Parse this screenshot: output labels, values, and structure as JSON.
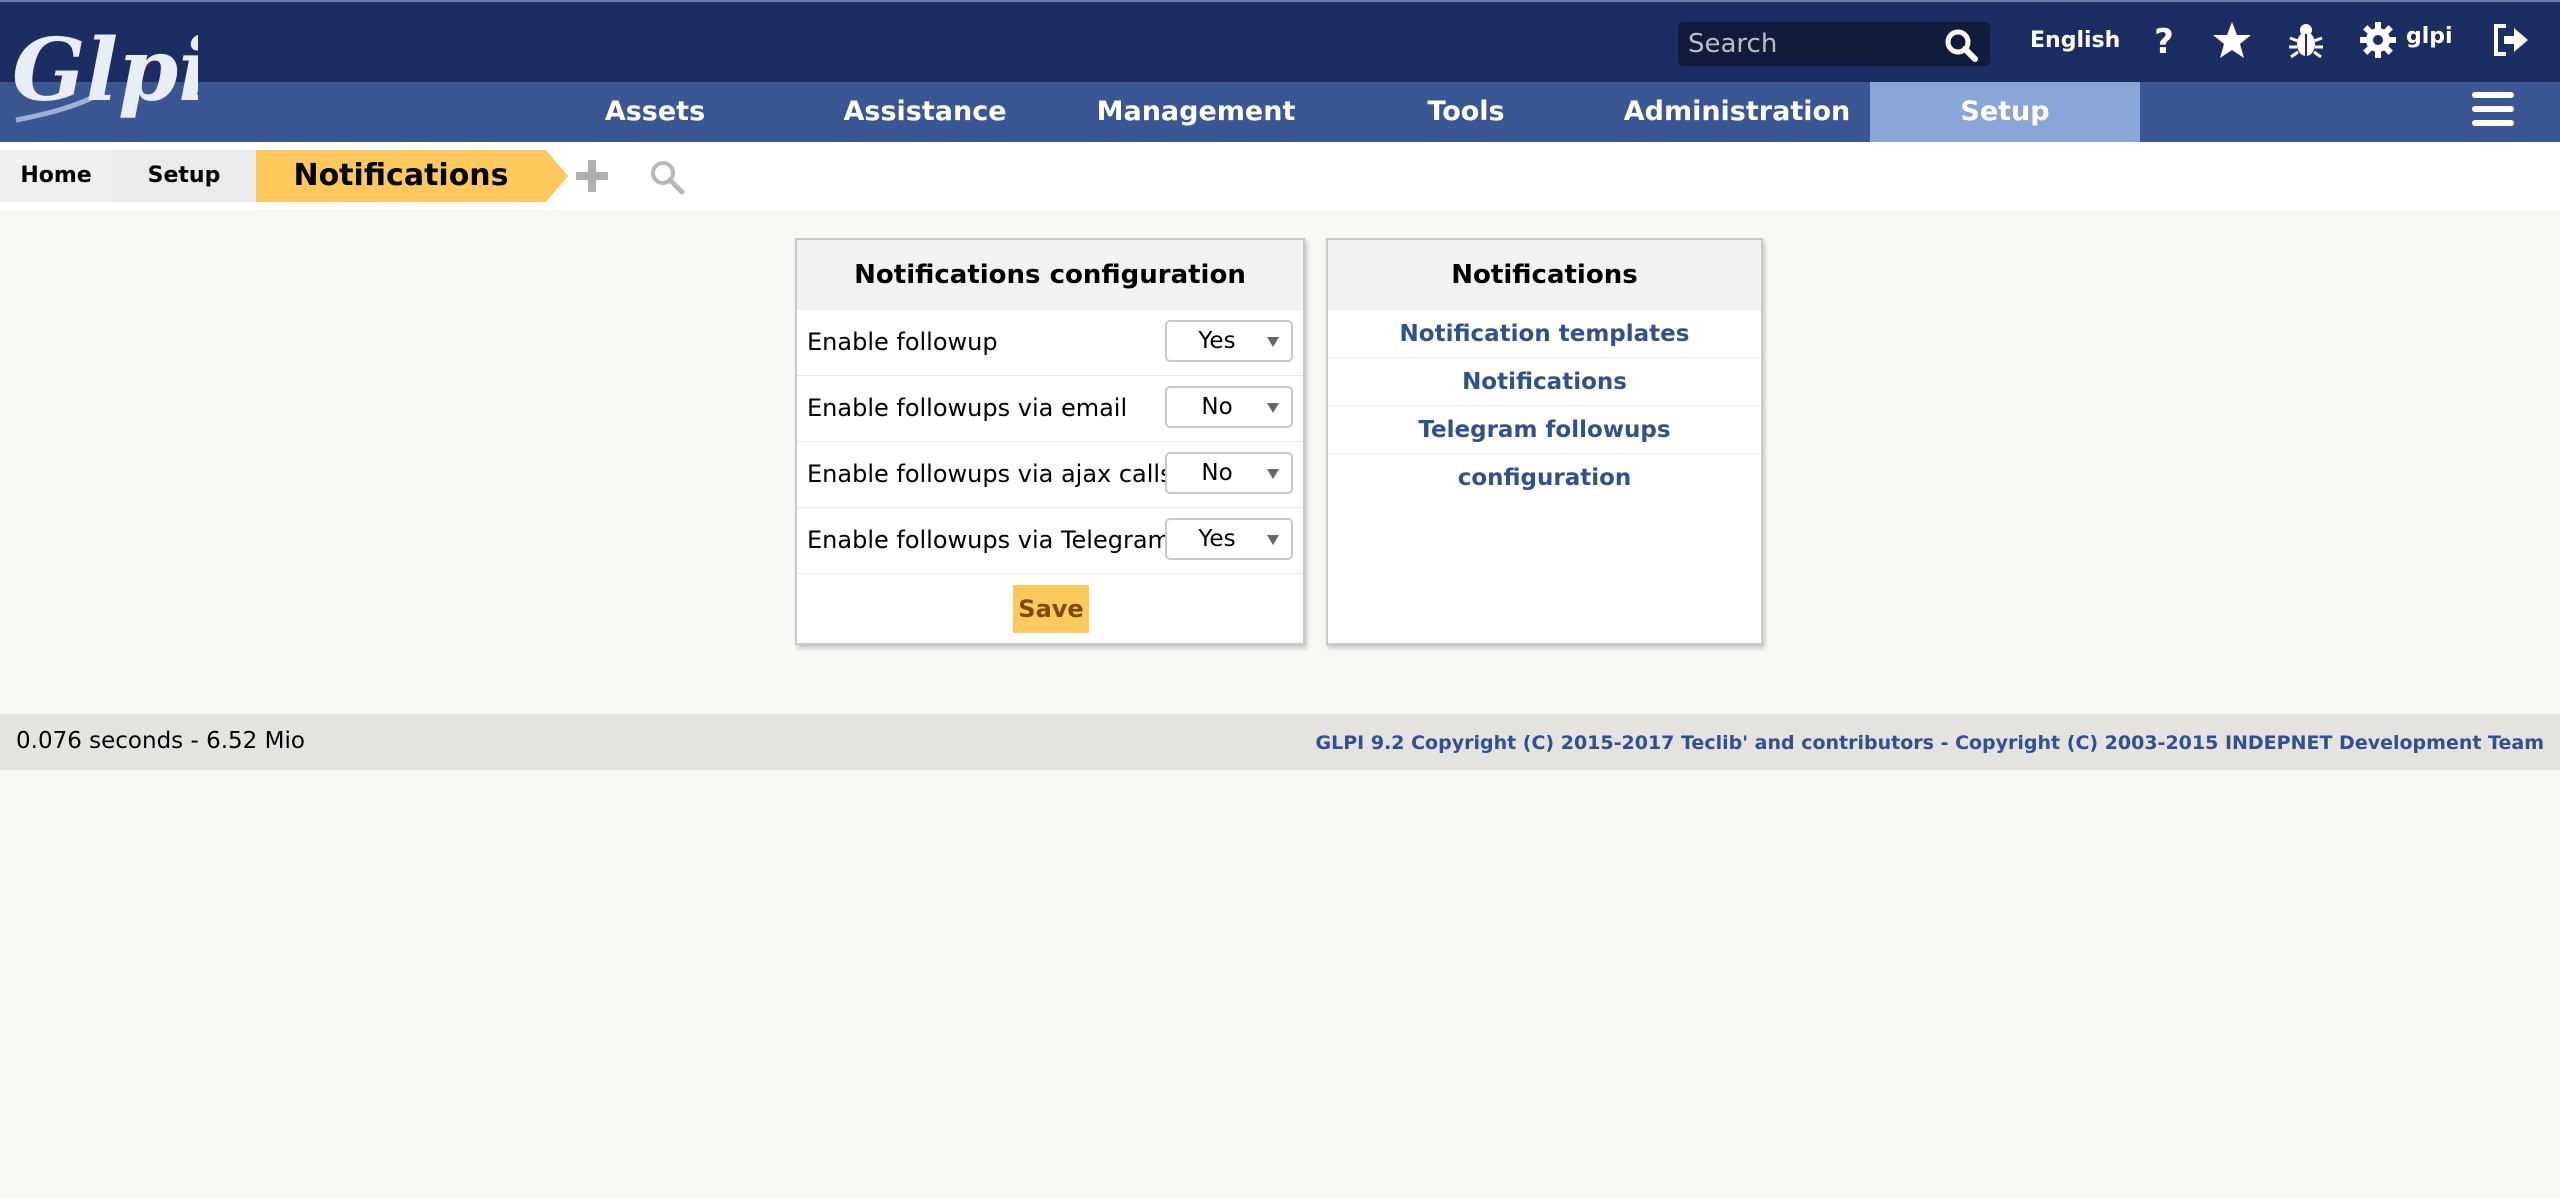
{
  "header": {
    "logo_text": "Glpi",
    "search_placeholder": "Search",
    "language": "English",
    "username": "glpi",
    "nav": [
      {
        "label": "Assets"
      },
      {
        "label": "Assistance"
      },
      {
        "label": "Management"
      },
      {
        "label": "Tools"
      },
      {
        "label": "Administration"
      },
      {
        "label": "Setup",
        "active": true
      }
    ],
    "icons": [
      "search-icon",
      "help-icon",
      "star-icon",
      "bug-icon",
      "gear-icon",
      "logout-icon",
      "hamburger-icon"
    ]
  },
  "breadcrumb": {
    "items": [
      {
        "label": "Home"
      },
      {
        "label": "Setup"
      },
      {
        "label": "Notifications"
      }
    ],
    "icons": [
      "plus-icon",
      "search-icon"
    ]
  },
  "config_panel": {
    "title": "Notifications configuration",
    "rows": [
      {
        "label": "Enable followup",
        "value": "Yes"
      },
      {
        "label": "Enable followups via email",
        "value": "No"
      },
      {
        "label": "Enable followups via ajax calls",
        "value": "No"
      },
      {
        "label": "Enable followups via Telegram",
        "value": "Yes"
      }
    ],
    "save_label": "Save"
  },
  "notifications_panel": {
    "title": "Notifications",
    "links": [
      {
        "label": "Notification templates"
      },
      {
        "label": "Notifications"
      },
      {
        "label": "Telegram followups configuration"
      }
    ]
  },
  "footer": {
    "timing": "0.076 seconds - 6.52 Mio",
    "copyright": "GLPI 9.2 Copyright (C) 2015-2017 Teclib' and contributors - Copyright (C) 2003-2015 INDEPNET Development Team"
  },
  "colors": {
    "header_dark": "#1c2d63",
    "header_nav": "#3a5693",
    "nav_active": "#8aa5d6",
    "accent_yellow": "#fec95c",
    "link_blue": "#30508f"
  }
}
